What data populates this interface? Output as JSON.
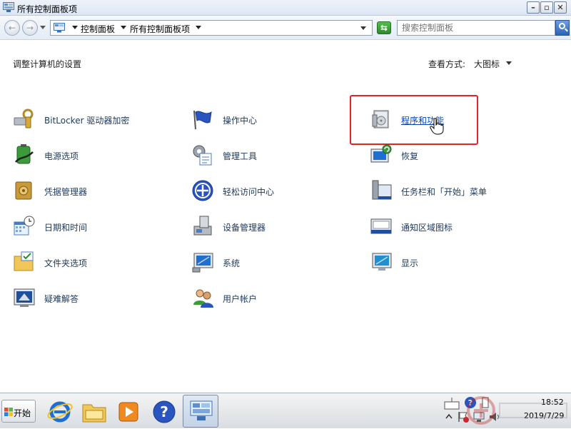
{
  "window": {
    "title": "所有控制面板项"
  },
  "address": {
    "crumbs": [
      "控制面板",
      "所有控制面板项"
    ],
    "search_placeholder": "搜索控制面板"
  },
  "content": {
    "heading": "调整计算机的设置",
    "view_label": "查看方式:",
    "view_value": "大图标"
  },
  "items": [
    {
      "label": "BitLocker 驱动器加密",
      "icon": "bitlocker-icon"
    },
    {
      "label": "操作中心",
      "icon": "action-center-flag-icon"
    },
    {
      "label": "程序和功能",
      "icon": "programs-features-icon",
      "hovered": true
    },
    {
      "label": "电源选项",
      "icon": "power-battery-icon"
    },
    {
      "label": "管理工具",
      "icon": "admin-tools-icon"
    },
    {
      "label": "恢复",
      "icon": "recovery-icon"
    },
    {
      "label": "凭据管理器",
      "icon": "credential-safe-icon"
    },
    {
      "label": "轻松访问中心",
      "icon": "ease-of-access-icon"
    },
    {
      "label": "任务栏和「开始」菜单",
      "icon": "taskbar-start-icon"
    },
    {
      "label": "日期和时间",
      "icon": "date-time-icon"
    },
    {
      "label": "设备管理器",
      "icon": "device-manager-icon"
    },
    {
      "label": "通知区域图标",
      "icon": "notification-area-icon"
    },
    {
      "label": "文件夹选项",
      "icon": "folder-options-icon"
    },
    {
      "label": "系统",
      "icon": "system-computer-icon"
    },
    {
      "label": "显示",
      "icon": "display-monitor-icon"
    },
    {
      "label": "疑难解答",
      "icon": "troubleshooting-icon"
    },
    {
      "label": "用户帐户",
      "icon": "user-accounts-icon"
    }
  ],
  "taskbar": {
    "start_label": "开始",
    "clock_time": "18:52",
    "clock_date": "2019/7/29"
  },
  "colors": {
    "link": "#1e395b",
    "highlight": "#e0262b",
    "accent": "#2a63b8"
  }
}
